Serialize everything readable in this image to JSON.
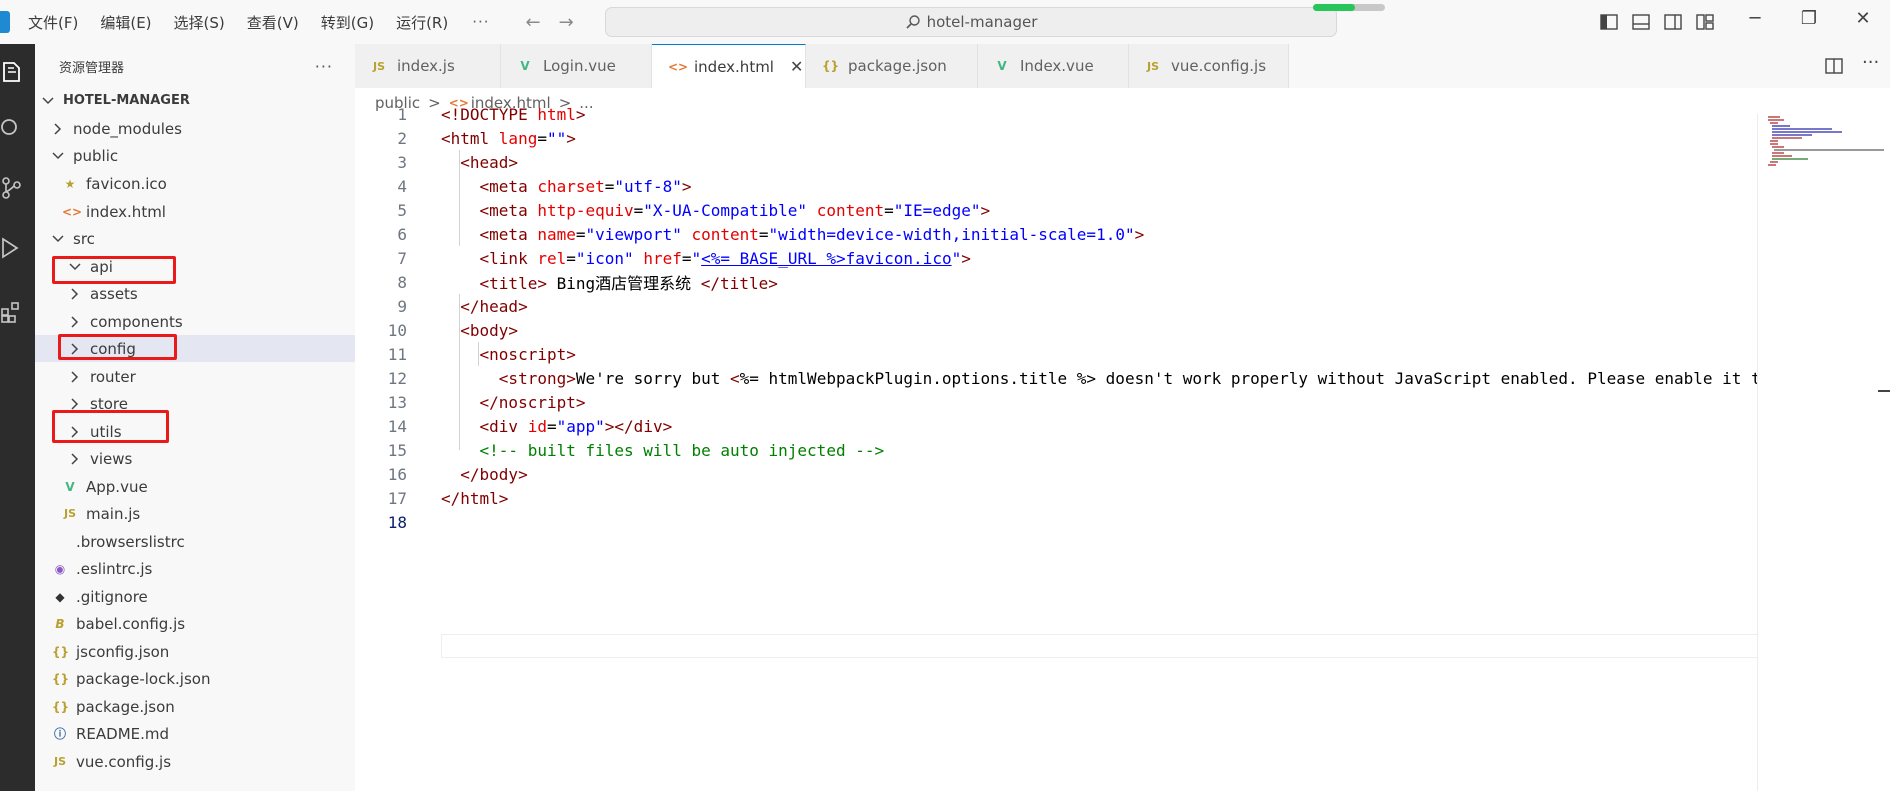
{
  "menu": [
    "文件(F)",
    "编辑(E)",
    "选择(S)",
    "查看(V)",
    "转到(G)",
    "运行(R)"
  ],
  "menu_more": "···",
  "command_center": {
    "text": "hotel-manager",
    "icon": "search-icon"
  },
  "sidebar": {
    "title": "资源管理器",
    "more": "···",
    "project": "HOTEL-MANAGER",
    "items": [
      {
        "label": "node_modules",
        "kind": "folder",
        "expanded": false
      },
      {
        "label": "public",
        "kind": "folder",
        "expanded": true
      },
      {
        "label": "favicon.ico",
        "kind": "file",
        "icon": "★"
      },
      {
        "label": "index.html",
        "kind": "file",
        "icon": "<>"
      },
      {
        "label": "src",
        "kind": "folder",
        "expanded": true
      },
      {
        "label": "api",
        "kind": "folder",
        "expanded": true
      },
      {
        "label": "assets",
        "kind": "folder",
        "expanded": false
      },
      {
        "label": "components",
        "kind": "folder",
        "expanded": false
      },
      {
        "label": "config",
        "kind": "folder",
        "expanded": false
      },
      {
        "label": "router",
        "kind": "folder",
        "expanded": false
      },
      {
        "label": "store",
        "kind": "folder",
        "expanded": false
      },
      {
        "label": "utils",
        "kind": "folder",
        "expanded": false
      },
      {
        "label": "views",
        "kind": "folder",
        "expanded": false
      },
      {
        "label": "App.vue",
        "kind": "file",
        "icon": "V"
      },
      {
        "label": "main.js",
        "kind": "file",
        "icon": "JS"
      },
      {
        "label": ".browserslistrc",
        "kind": "file",
        "icon": ""
      },
      {
        "label": ".eslintrc.js",
        "kind": "file",
        "icon": "◉"
      },
      {
        "label": ".gitignore",
        "kind": "file",
        "icon": "◆"
      },
      {
        "label": "babel.config.js",
        "kind": "file",
        "icon": "B"
      },
      {
        "label": "jsconfig.json",
        "kind": "file",
        "icon": "{}"
      },
      {
        "label": "package-lock.json",
        "kind": "file",
        "icon": "{}"
      },
      {
        "label": "package.json",
        "kind": "file",
        "icon": "{}"
      },
      {
        "label": "README.md",
        "kind": "file",
        "icon": "ⓘ"
      },
      {
        "label": "vue.config.js",
        "kind": "file",
        "icon": "JS"
      }
    ]
  },
  "tabs": [
    {
      "label": "index.js",
      "icon": "JS",
      "active": false
    },
    {
      "label": "Login.vue",
      "icon": "V",
      "active": false
    },
    {
      "label": "index.html",
      "icon": "<>",
      "active": true,
      "close": "✕"
    },
    {
      "label": "package.json",
      "icon": "{}",
      "active": false
    },
    {
      "label": "Index.vue",
      "icon": "V",
      "active": false
    },
    {
      "label": "vue.config.js",
      "icon": "JS",
      "active": false
    }
  ],
  "breadcrumb": {
    "folder": "public",
    "sep": ">",
    "file_icon": "<>",
    "file": "index.html",
    "tail": "..."
  },
  "editor": {
    "current_line": 18,
    "lines": [
      [
        [
          "t-tag",
          "<!DOCTYPE "
        ],
        [
          "t-attr",
          "html"
        ],
        [
          "t-tag",
          ">"
        ]
      ],
      [
        [
          "t-tag",
          "<html "
        ],
        [
          "t-attr",
          "lang"
        ],
        [
          "t-txt",
          "="
        ],
        [
          "t-str",
          "\"\""
        ],
        [
          "t-tag",
          ">"
        ]
      ],
      [
        [
          "t-txt",
          "  "
        ],
        [
          "t-tag",
          "<head>"
        ]
      ],
      [
        [
          "t-txt",
          "    "
        ],
        [
          "t-tag",
          "<meta "
        ],
        [
          "t-attr",
          "charset"
        ],
        [
          "t-txt",
          "="
        ],
        [
          "t-str",
          "\"utf-8\""
        ],
        [
          "t-tag",
          ">"
        ]
      ],
      [
        [
          "t-txt",
          "    "
        ],
        [
          "t-tag",
          "<meta "
        ],
        [
          "t-attr",
          "http-equiv"
        ],
        [
          "t-txt",
          "="
        ],
        [
          "t-str",
          "\"X-UA-Compatible\""
        ],
        [
          "t-txt",
          " "
        ],
        [
          "t-attr",
          "content"
        ],
        [
          "t-txt",
          "="
        ],
        [
          "t-str",
          "\"IE=edge\""
        ],
        [
          "t-tag",
          ">"
        ]
      ],
      [
        [
          "t-txt",
          "    "
        ],
        [
          "t-tag",
          "<meta "
        ],
        [
          "t-attr",
          "name"
        ],
        [
          "t-txt",
          "="
        ],
        [
          "t-str",
          "\"viewport\""
        ],
        [
          "t-txt",
          " "
        ],
        [
          "t-attr",
          "content"
        ],
        [
          "t-txt",
          "="
        ],
        [
          "t-str",
          "\"width=device-width,initial-scale=1.0\""
        ],
        [
          "t-tag",
          ">"
        ]
      ],
      [
        [
          "t-txt",
          "    "
        ],
        [
          "t-tag",
          "<link "
        ],
        [
          "t-attr",
          "rel"
        ],
        [
          "t-txt",
          "="
        ],
        [
          "t-str",
          "\"icon\""
        ],
        [
          "t-txt",
          " "
        ],
        [
          "t-attr",
          "href"
        ],
        [
          "t-txt",
          "="
        ],
        [
          "t-str",
          "\""
        ],
        [
          "t-link",
          "<%= BASE_URL %>favicon.ico"
        ],
        [
          "t-str",
          "\""
        ],
        [
          "t-tag",
          ">"
        ]
      ],
      [
        [
          "t-txt",
          "    "
        ],
        [
          "t-tag",
          "<title>"
        ],
        [
          "t-txt",
          " Bing酒店管理系统 "
        ],
        [
          "t-tag",
          "</title>"
        ]
      ],
      [
        [
          "t-txt",
          "  "
        ],
        [
          "t-tag",
          "</head>"
        ]
      ],
      [
        [
          "t-txt",
          "  "
        ],
        [
          "t-tag",
          "<body>"
        ]
      ],
      [
        [
          "t-txt",
          "    "
        ],
        [
          "t-tag",
          "<noscript>"
        ]
      ],
      [
        [
          "t-txt",
          "      "
        ],
        [
          "t-tag",
          "<strong>"
        ],
        [
          "t-txt",
          "We're sorry but "
        ],
        [
          "t-tag",
          "<"
        ],
        [
          "t-txt",
          "%= htmlWebpackPlugin.options.title %> doesn't work properly without JavaScript enabled. Please enable it t"
        ]
      ],
      [
        [
          "t-txt",
          "    "
        ],
        [
          "t-tag",
          "</noscript>"
        ]
      ],
      [
        [
          "t-txt",
          "    "
        ],
        [
          "t-tag",
          "<div "
        ],
        [
          "t-attr",
          "id"
        ],
        [
          "t-txt",
          "="
        ],
        [
          "t-str",
          "\"app\""
        ],
        [
          "t-tag",
          "></div>"
        ]
      ],
      [
        [
          "t-txt",
          "    "
        ],
        [
          "t-com",
          "<!-- built files will be auto injected -->"
        ]
      ],
      [
        [
          "t-txt",
          "  "
        ],
        [
          "t-tag",
          "</body>"
        ]
      ],
      [
        [
          "t-tag",
          "</html>"
        ]
      ],
      []
    ]
  },
  "colors": {
    "accent": "#0078d4",
    "highlight_box": "#ea1a1a",
    "vue_green": "#41b883",
    "progress": "#27c55a"
  },
  "progress": 0.58
}
